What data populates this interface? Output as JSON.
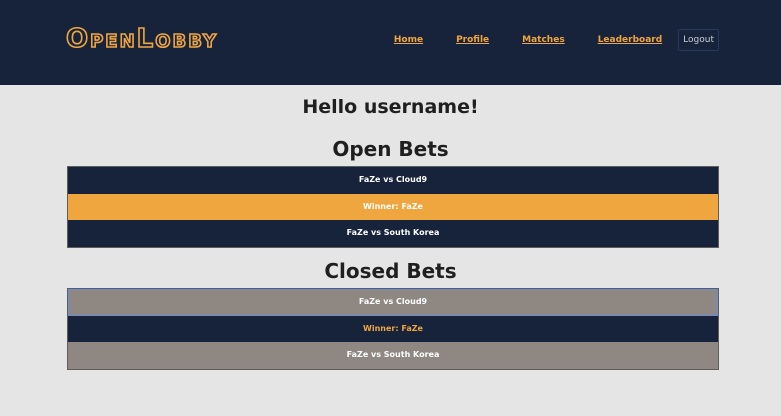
{
  "header": {
    "logo_text": "OpenLobby",
    "nav": {
      "home": "Home",
      "profile": "Profile",
      "matches": "Matches",
      "leaderboard": "Leaderboard"
    },
    "logout_label": "Logout"
  },
  "main": {
    "greeting": "Hello username!",
    "open_bets": {
      "title": "Open Bets",
      "rows": [
        "FaZe vs Cloud9",
        "Winner: FaZe",
        "FaZe vs South Korea"
      ]
    },
    "closed_bets": {
      "title": "Closed Bets",
      "rows": [
        "FaZe vs Cloud9",
        "Winner: FaZe",
        "FaZe vs South Korea"
      ]
    }
  },
  "colors": {
    "navy": "#17223b",
    "orange": "#f0a63f",
    "gray": "#8f8781",
    "background": "#e5e5e5"
  }
}
